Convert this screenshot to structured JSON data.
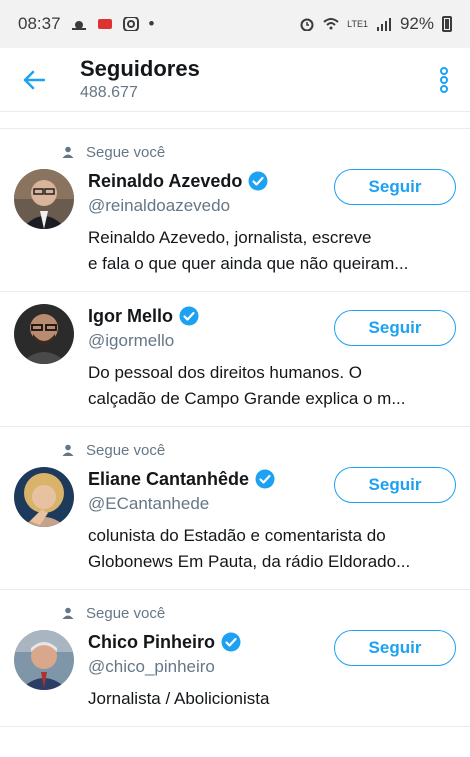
{
  "status_bar": {
    "time": "08:37",
    "battery": "92%",
    "network": "LTE1"
  },
  "header": {
    "title": "Seguidores",
    "count": "488.677"
  },
  "users": [
    {
      "follows_you": "Segue você",
      "name": "Reinaldo Azevedo",
      "handle": "@reinaldoazevedo",
      "bio1": "Reinaldo Azevedo, jornalista, escreve",
      "bio2": "e fala o que quer ainda que não queiram...",
      "button": "Seguir"
    },
    {
      "follows_you": "",
      "name": "Igor Mello",
      "handle": "@igormello",
      "bio1": "Do pessoal dos direitos humanos. O",
      "bio2": "calçadão de Campo Grande explica o m...",
      "button": "Seguir"
    },
    {
      "follows_you": "Segue você",
      "name": "Eliane Cantanhêde",
      "handle": "@ECantanhede",
      "bio1": "colunista do Estadão e comentarista do",
      "bio2": "Globonews Em Pauta, da rádio Eldorado...",
      "button": "Seguir"
    },
    {
      "follows_you": "Segue você",
      "name": "Chico Pinheiro",
      "handle": "@chico_pinheiro",
      "bio1": "Jornalista / Abolicionista",
      "bio2": "",
      "button": "Seguir"
    }
  ],
  "colors": {
    "accent": "#1da1f2",
    "secondary_text": "#657786",
    "primary_text": "#14171a"
  }
}
